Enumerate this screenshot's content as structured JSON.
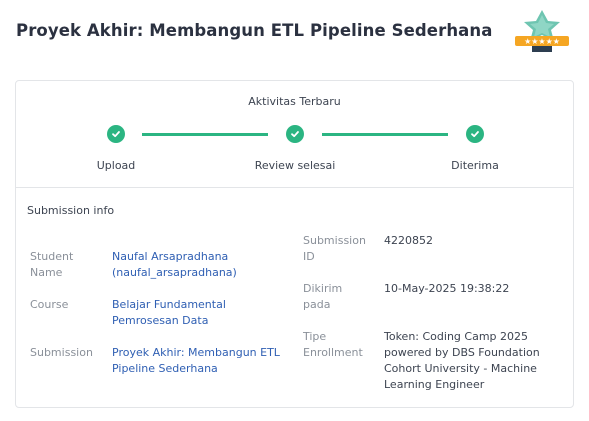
{
  "page": {
    "title": "Proyek Akhir: Membangun ETL Pipeline Sederhana"
  },
  "badge": {
    "icon": "star-rating-badge-icon",
    "star_count": 5,
    "colors": {
      "star": "#6ec5b1",
      "ribbon": "#f5a623",
      "stand": "#2d3e50"
    }
  },
  "activity": {
    "title": "Aktivitas Terbaru",
    "steps": [
      {
        "label": "Upload",
        "status": "done"
      },
      {
        "label": "Review selesai",
        "status": "done"
      },
      {
        "label": "Diterima",
        "status": "done"
      }
    ],
    "accent_color": "#2bb582"
  },
  "submission": {
    "title": "Submission info",
    "student_name": {
      "label": "Student Name",
      "value": "Naufal Arsapradhana (naufal_arsapradhana)"
    },
    "course": {
      "label": "Course",
      "value": "Belajar Fundamental Pemrosesan Data"
    },
    "submission": {
      "label": "Submission",
      "value": "Proyek Akhir: Membangun ETL Pipeline Sederhana"
    },
    "submission_id": {
      "label": "Submission ID",
      "value": "4220852"
    },
    "sent_at": {
      "label": "Dikirim pada",
      "value": "10-May-2025 19:38:22"
    },
    "enrollment_type": {
      "label": "Tipe Enrollment",
      "value": "Token: Coding Camp 2025 powered by DBS Foundation Cohort University - Machine Learning Engineer"
    }
  },
  "colors": {
    "link": "#2f5fb3",
    "label": "#8a9099",
    "text": "#3d4451"
  }
}
